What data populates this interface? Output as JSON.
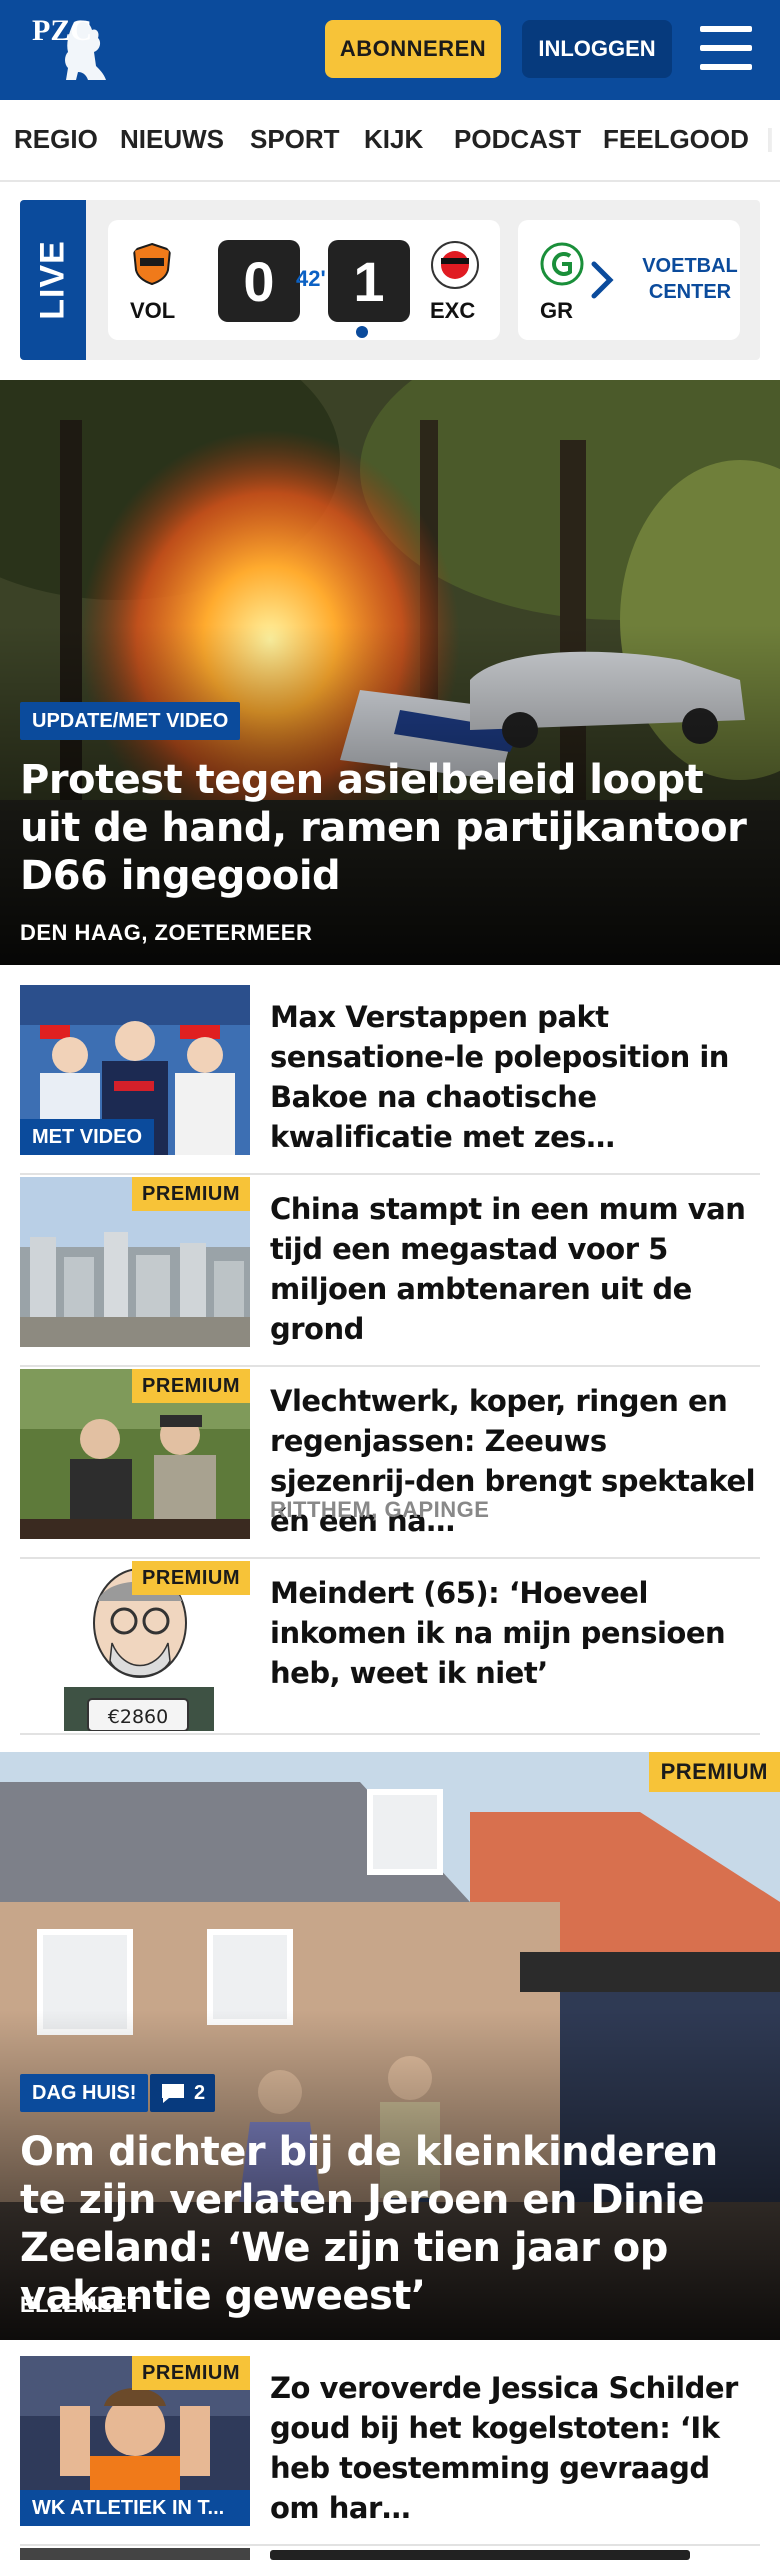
{
  "header": {
    "logo_text": "PZC",
    "subscribe_label": "ABONNEREN",
    "login_label": "INLOGGEN",
    "colors": {
      "brand": "#0b4b9c",
      "accent": "#f7c338"
    }
  },
  "nav": {
    "items": [
      "REGIO",
      "NIEUWS",
      "SPORT",
      "KIJK",
      "PODCAST",
      "FEELGOOD"
    ]
  },
  "live": {
    "label": "LIVE",
    "match": {
      "home": "VOL",
      "away": "EXC",
      "home_score": "0",
      "away_score": "1",
      "minute": "42'"
    },
    "next_team": "GR",
    "center_label_1": "VOETBAL",
    "center_label_2": "CENTER"
  },
  "hero": {
    "badge": "UPDATE/MET VIDEO",
    "title": "Protest tegen asielbeleid loopt uit de hand, ramen partijkantoor D66 ingegooid",
    "location": "DEN HAAG, ZOETERMEER"
  },
  "articles": [
    {
      "title": "Max Verstappen pakt sensatione-le poleposition in Bakoe na chaotische kwalificatie met zes…",
      "thumb_label": "MET VIDEO",
      "premium": "",
      "location": ""
    },
    {
      "title": "China stampt in een mum van tijd een megastad voor 5 miljoen ambtenaren uit de grond",
      "thumb_label": "",
      "premium": "PREMIUM",
      "location": ""
    },
    {
      "title": "Vlechtwerk, koper, ringen en regenjassen: Zeeuws sjezenrij-den brengt spektakel én een na…",
      "thumb_label": "",
      "premium": "PREMIUM",
      "location": "RITTHEM, GAPINGE"
    },
    {
      "title": "Meindert (65): ‘Hoeveel inkomen ik na mijn pensioen heb, weet ik niet’",
      "thumb_label": "",
      "premium": "PREMIUM",
      "location": "",
      "sign_text": "€2860"
    }
  ],
  "feature": {
    "premium": "PREMIUM",
    "badge": "DAG HUIS!",
    "comments": "2",
    "title": "Om dichter bij de kleinkinderen te zijn verlaten Jeroen en Dinie Zeeland: ‘We zijn tien jaar op vakantie geweest’",
    "location": "ELLEMEET"
  },
  "article_last": {
    "premium": "PREMIUM",
    "title": "Zo veroverde Jessica Schilder goud bij het kogelstoten: ‘Ik heb toestemming gevraagd om har…",
    "thumb_label": "WK ATLETIEK IN T..."
  }
}
